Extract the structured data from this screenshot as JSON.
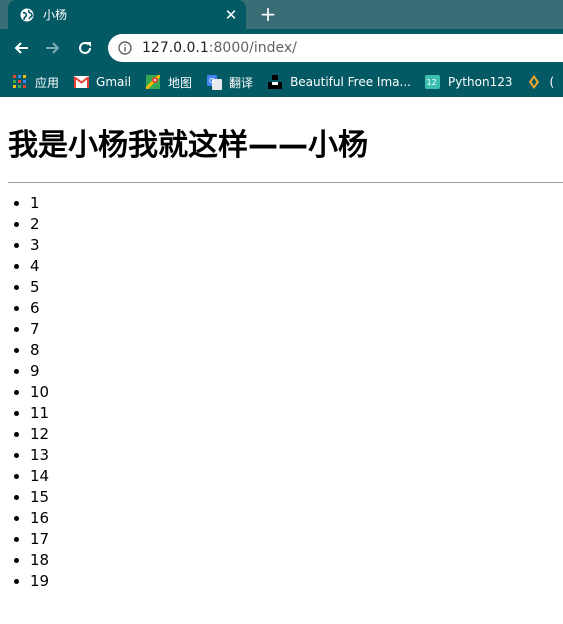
{
  "browser": {
    "tab": {
      "title": "小杨",
      "favicon": "globe-icon",
      "close": "✕"
    },
    "new_tab": "+",
    "nav": {
      "back": "arrow-left-icon",
      "forward": "arrow-right-icon",
      "reload": "reload-icon"
    },
    "address": {
      "host": "127.0.0.1",
      "rest": ":8000/index/"
    },
    "bookmarks": [
      {
        "label": "应用",
        "icon": "apps-grid-icon"
      },
      {
        "label": "Gmail",
        "icon": "gmail-icon"
      },
      {
        "label": "地图",
        "icon": "maps-icon"
      },
      {
        "label": "翻译",
        "icon": "translate-icon"
      },
      {
        "label": "Beautiful Free Ima...",
        "icon": "unsplash-icon"
      },
      {
        "label": "Python123",
        "icon": "python123-icon"
      },
      {
        "label": "(",
        "icon": "bookmark-icon"
      }
    ],
    "colors": {
      "frame": "#035a65",
      "tabstrip": "#3a6e76"
    }
  },
  "page": {
    "heading": "我是小杨我就这样——小杨",
    "items": [
      "1",
      "2",
      "3",
      "4",
      "5",
      "6",
      "7",
      "8",
      "9",
      "10",
      "11",
      "12",
      "13",
      "14",
      "15",
      "16",
      "17",
      "18",
      "19"
    ]
  }
}
